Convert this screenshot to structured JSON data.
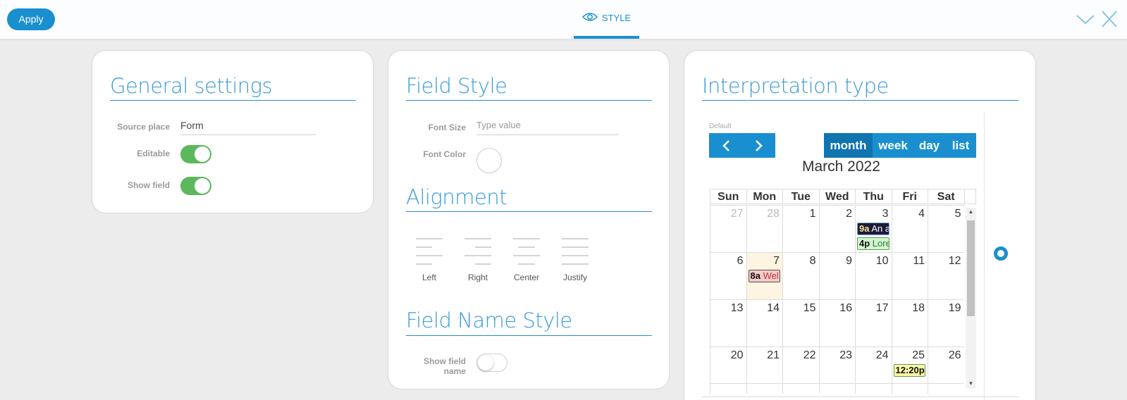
{
  "toolbar": {
    "apply_label": "Apply",
    "tab_label": "STYLE"
  },
  "general": {
    "title": "General settings",
    "source_place_label": "Source place",
    "source_place_value": "Form",
    "editable_label": "Editable",
    "editable_on": true,
    "show_field_label": "Show field",
    "show_field_on": true
  },
  "field_style": {
    "title": "Field Style",
    "font_size_label": "Font Size",
    "font_size_placeholder": "Type value",
    "font_color_label": "Font Color"
  },
  "alignment": {
    "title": "Alignment",
    "options": [
      "Left",
      "Right",
      "Center",
      "Justify"
    ]
  },
  "field_name_style": {
    "title": "Field Name Style",
    "show_field_name_label_1": "Show field",
    "show_field_name_label_2": "name",
    "show_field_name_on": false
  },
  "interpretation": {
    "title": "Interpretation type",
    "default_label": "Default",
    "views": [
      "month",
      "week",
      "day",
      "list"
    ],
    "active_view": "month",
    "month_title": "March 2022",
    "weekdays": [
      "Sun",
      "Mon",
      "Tue",
      "Wed",
      "Thu",
      "Fri",
      "Sat"
    ],
    "weeks": [
      [
        "27",
        "28",
        "1",
        "2",
        "3",
        "4",
        "5"
      ],
      [
        "6",
        "7",
        "8",
        "9",
        "10",
        "11",
        "12"
      ],
      [
        "13",
        "14",
        "15",
        "16",
        "17",
        "18",
        "19"
      ],
      [
        "20",
        "21",
        "22",
        "23",
        "24",
        "25",
        "26"
      ]
    ],
    "events": [
      {
        "time": "9a",
        "title": "An a"
      },
      {
        "time": "4p",
        "title": "Lore"
      },
      {
        "time": "8a",
        "title": "Wel"
      },
      {
        "time": "12:20p",
        "title": ""
      }
    ]
  },
  "colors": {
    "accent": "#1a8fd0",
    "toggle_on": "#5cb85c",
    "today_bg": "#fdf5e1"
  }
}
